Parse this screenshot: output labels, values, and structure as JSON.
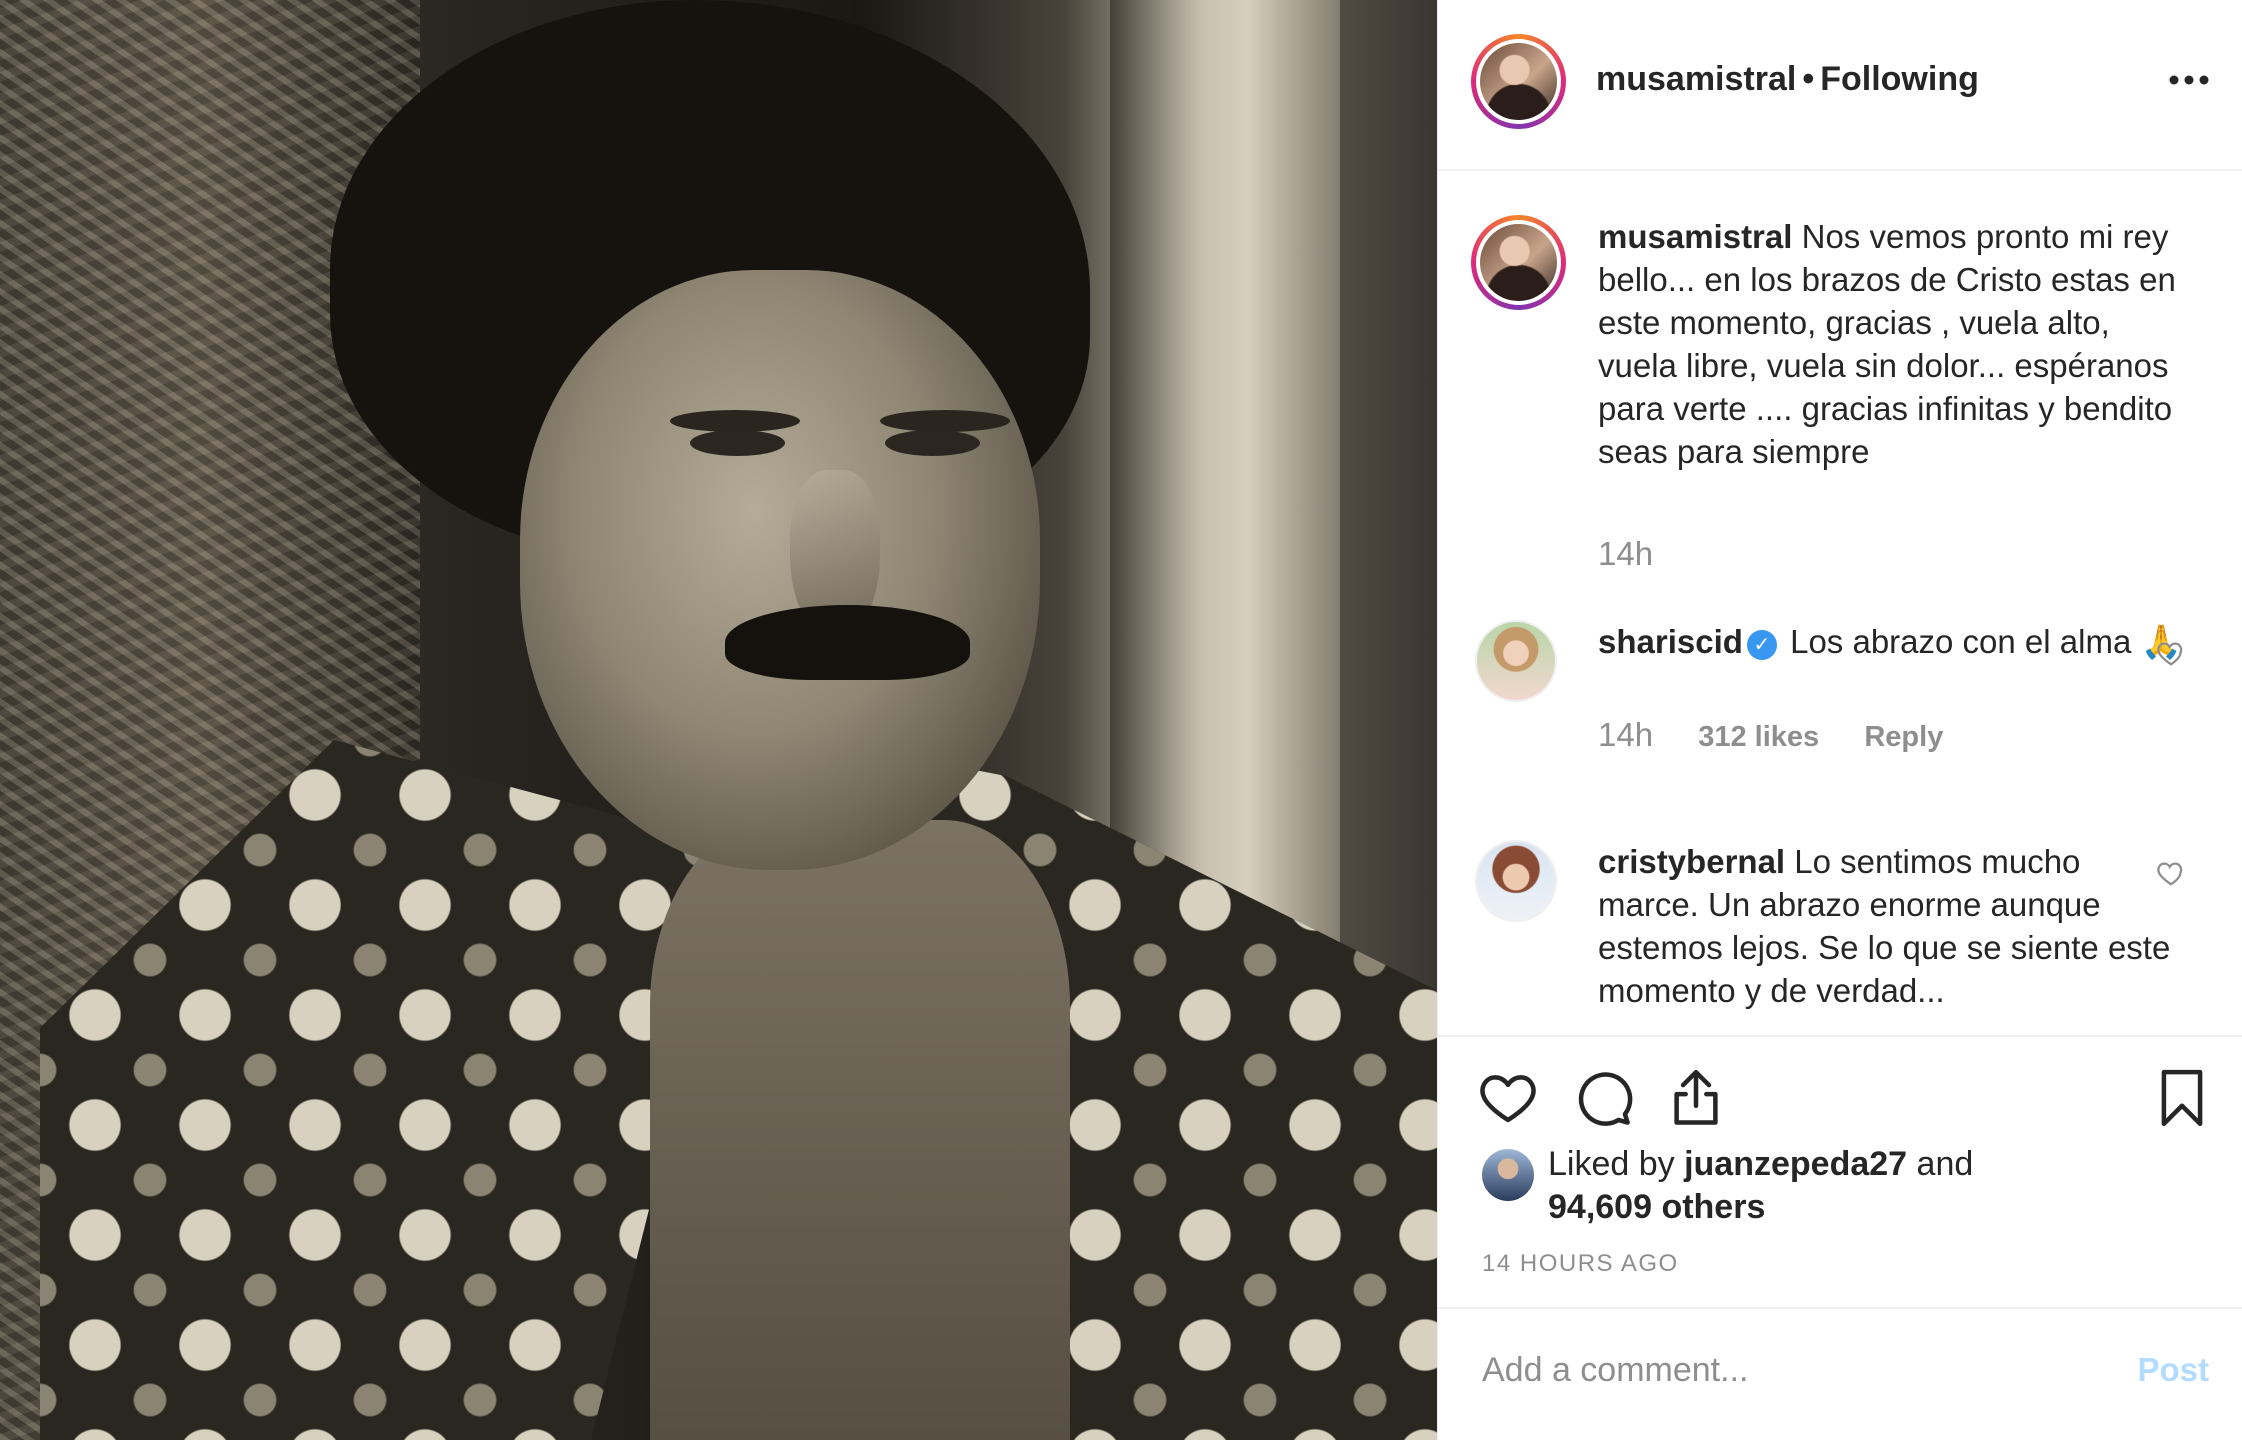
{
  "photo": {
    "alt_icon": "photo-image"
  },
  "header": {
    "username": "musamistral",
    "separator": "•",
    "follow_status": "Following",
    "more_icon": "more-horizontal-icon"
  },
  "caption": {
    "username": "musamistral",
    "text": "Nos vemos pronto mi rey bello... en los brazos de Cristo estas en este momento, gracias , vuela alto, vuela libre, vuela sin dolor... espéranos para verte .... gracias infinitas y bendito seas para siempre",
    "time": "14h"
  },
  "comments": [
    {
      "username": "shariscid",
      "verified": true,
      "text": "Los abrazo con el alma 🙏",
      "time": "14h",
      "likes": "312 likes",
      "reply": "Reply"
    },
    {
      "username": "cristybernal",
      "verified": false,
      "text": "Lo sentimos mucho marce. Un abrazo enorme aunque estemos lejos. Se lo que se siente este momento y de verdad..."
    }
  ],
  "actions": {
    "like_icon": "heart-icon",
    "comment_icon": "comment-bubble-icon",
    "share_icon": "share-icon",
    "save_icon": "bookmark-icon"
  },
  "likes": {
    "prefix": "Liked by",
    "user": "juanzepeda27",
    "and": "and",
    "others": "94,609 others"
  },
  "timestamp": "14 HOURS AGO",
  "add_comment": {
    "placeholder": "Add a comment...",
    "post": "Post"
  },
  "colors": {
    "text": "#262626",
    "muted": "#8e8e8e",
    "divider": "#efefef",
    "verified": "#3897f0",
    "post_disabled": "#b3dbff"
  }
}
